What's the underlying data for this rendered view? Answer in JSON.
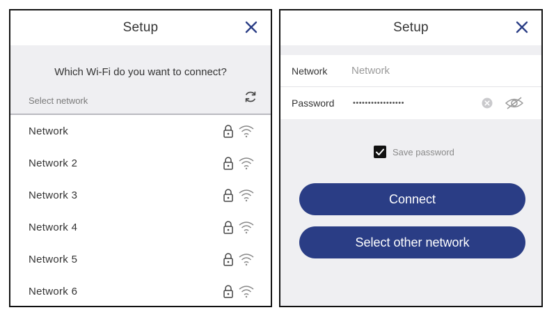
{
  "left": {
    "title": "Setup",
    "question": "Which Wi-Fi do you want to connect?",
    "select_label": "Select network",
    "networks": [
      {
        "name": "Network"
      },
      {
        "name": "Network 2"
      },
      {
        "name": "Network 3"
      },
      {
        "name": "Network 4"
      },
      {
        "name": "Network 5"
      },
      {
        "name": "Network 6"
      }
    ],
    "icons": {
      "close": "close-icon",
      "refresh": "refresh-icon",
      "lock": "lock-icon",
      "wifi": "wifi-icon"
    }
  },
  "right": {
    "title": "Setup",
    "network_label": "Network",
    "network_placeholder": "Network",
    "password_label": "Password",
    "password_mask": "•••••••••••••••••",
    "save_password_label": "Save password",
    "save_password_checked": true,
    "connect_label": "Connect",
    "other_label": "Select other network",
    "icons": {
      "close": "close-icon",
      "clear": "clear-icon",
      "visibility": "eye-off-icon",
      "check": "check-icon"
    }
  },
  "colors": {
    "accent": "#2a3d85",
    "background_gray": "#efeff2"
  }
}
